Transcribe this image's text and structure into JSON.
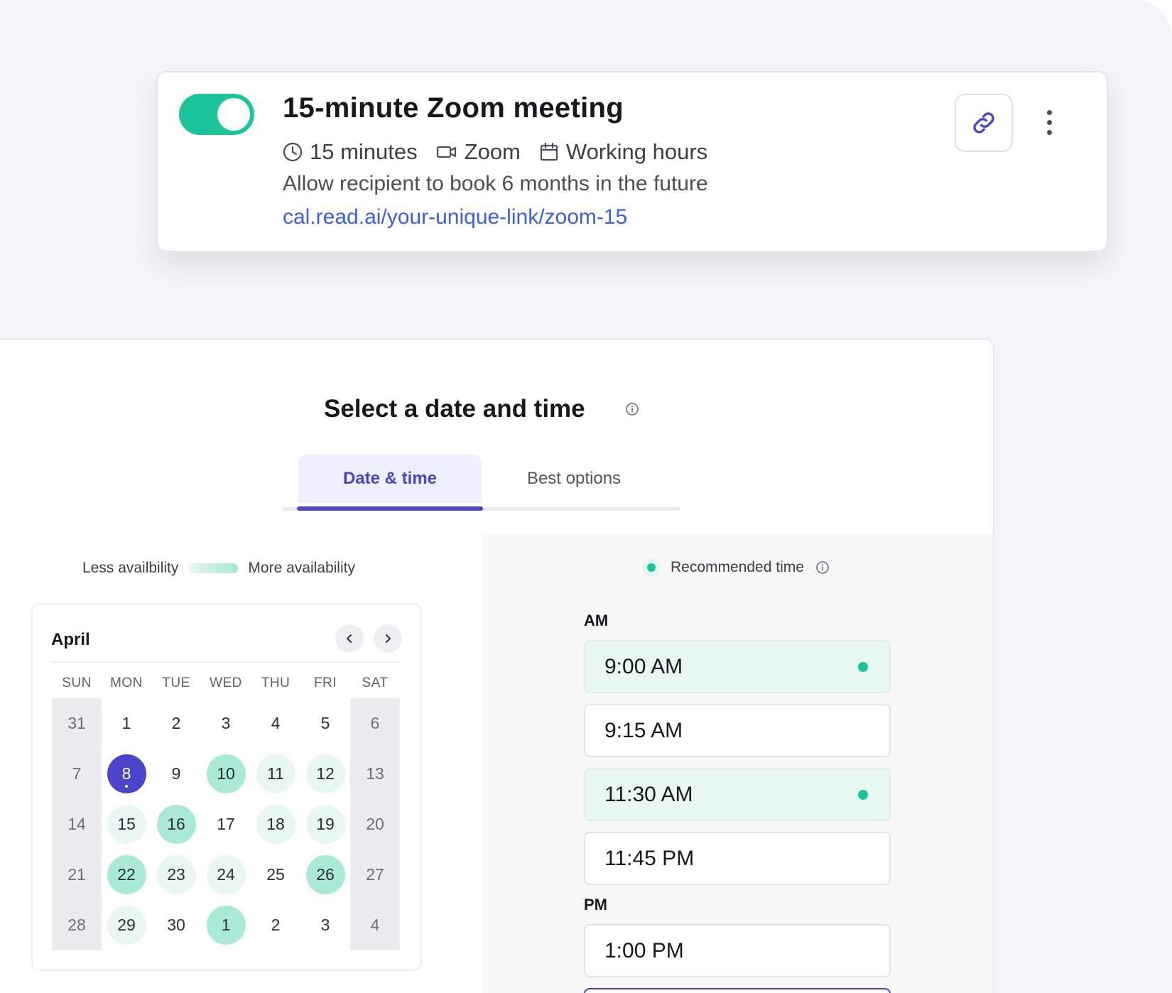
{
  "event": {
    "enabled": true,
    "title": "15-minute Zoom meeting",
    "duration": "15 minutes",
    "location": "Zoom",
    "availability": "Working hours",
    "description": "Allow recipient to book 6 months in the future",
    "link": "cal.read.ai/your-unique-link/zoom-15"
  },
  "scheduler": {
    "title": "Select a date and time",
    "tabs": [
      {
        "label": "Date & time",
        "active": true
      },
      {
        "label": "Best options",
        "active": false
      }
    ],
    "legend": {
      "less": "Less availbility",
      "more": "More availability"
    },
    "calendar": {
      "month": "April",
      "weekdays": [
        "SUN",
        "MON",
        "TUE",
        "WED",
        "THU",
        "FRI",
        "SAT"
      ],
      "weeks": [
        [
          {
            "d": "31",
            "lvl": 0
          },
          {
            "d": "1",
            "lvl": 0
          },
          {
            "d": "2",
            "lvl": 0
          },
          {
            "d": "3",
            "lvl": 0
          },
          {
            "d": "4",
            "lvl": 0
          },
          {
            "d": "5",
            "lvl": 0
          },
          {
            "d": "6",
            "lvl": 0
          }
        ],
        [
          {
            "d": "7",
            "lvl": 0
          },
          {
            "d": "8",
            "lvl": 0,
            "selected": true
          },
          {
            "d": "9",
            "lvl": 0
          },
          {
            "d": "10",
            "lvl": 2
          },
          {
            "d": "11",
            "lvl": 1
          },
          {
            "d": "12",
            "lvl": 1
          },
          {
            "d": "13",
            "lvl": 0
          }
        ],
        [
          {
            "d": "14",
            "lvl": 0
          },
          {
            "d": "15",
            "lvl": 1
          },
          {
            "d": "16",
            "lvl": 2
          },
          {
            "d": "17",
            "lvl": 0
          },
          {
            "d": "18",
            "lvl": 1
          },
          {
            "d": "19",
            "lvl": 1
          },
          {
            "d": "20",
            "lvl": 0
          }
        ],
        [
          {
            "d": "21",
            "lvl": 0
          },
          {
            "d": "22",
            "lvl": 2
          },
          {
            "d": "23",
            "lvl": 1
          },
          {
            "d": "24",
            "lvl": 1
          },
          {
            "d": "25",
            "lvl": 0
          },
          {
            "d": "26",
            "lvl": 2
          },
          {
            "d": "27",
            "lvl": 0
          }
        ],
        [
          {
            "d": "28",
            "lvl": 0
          },
          {
            "d": "29",
            "lvl": 1
          },
          {
            "d": "30",
            "lvl": 0
          },
          {
            "d": "1",
            "lvl": 2
          },
          {
            "d": "2",
            "lvl": 0
          },
          {
            "d": "3",
            "lvl": 0
          },
          {
            "d": "4",
            "lvl": 0
          }
        ]
      ]
    },
    "times": {
      "recommended_label": "Recommended time",
      "am_label": "AM",
      "pm_label": "PM",
      "am_slots": [
        {
          "time": "9:00 AM",
          "recommended": true
        },
        {
          "time": "9:15 AM",
          "recommended": false
        },
        {
          "time": "11:30 AM",
          "recommended": true
        },
        {
          "time": "11:45 PM",
          "recommended": false
        }
      ],
      "pm_slots": [
        {
          "time": "1:00 PM",
          "recommended": false
        }
      ]
    }
  },
  "colors": {
    "accent": "#4a45c9",
    "toggle_on": "#1cc49a",
    "link": "#3a5fe0",
    "high_availability": "#a9e9d5",
    "low_availability": "#e8f7f2"
  }
}
